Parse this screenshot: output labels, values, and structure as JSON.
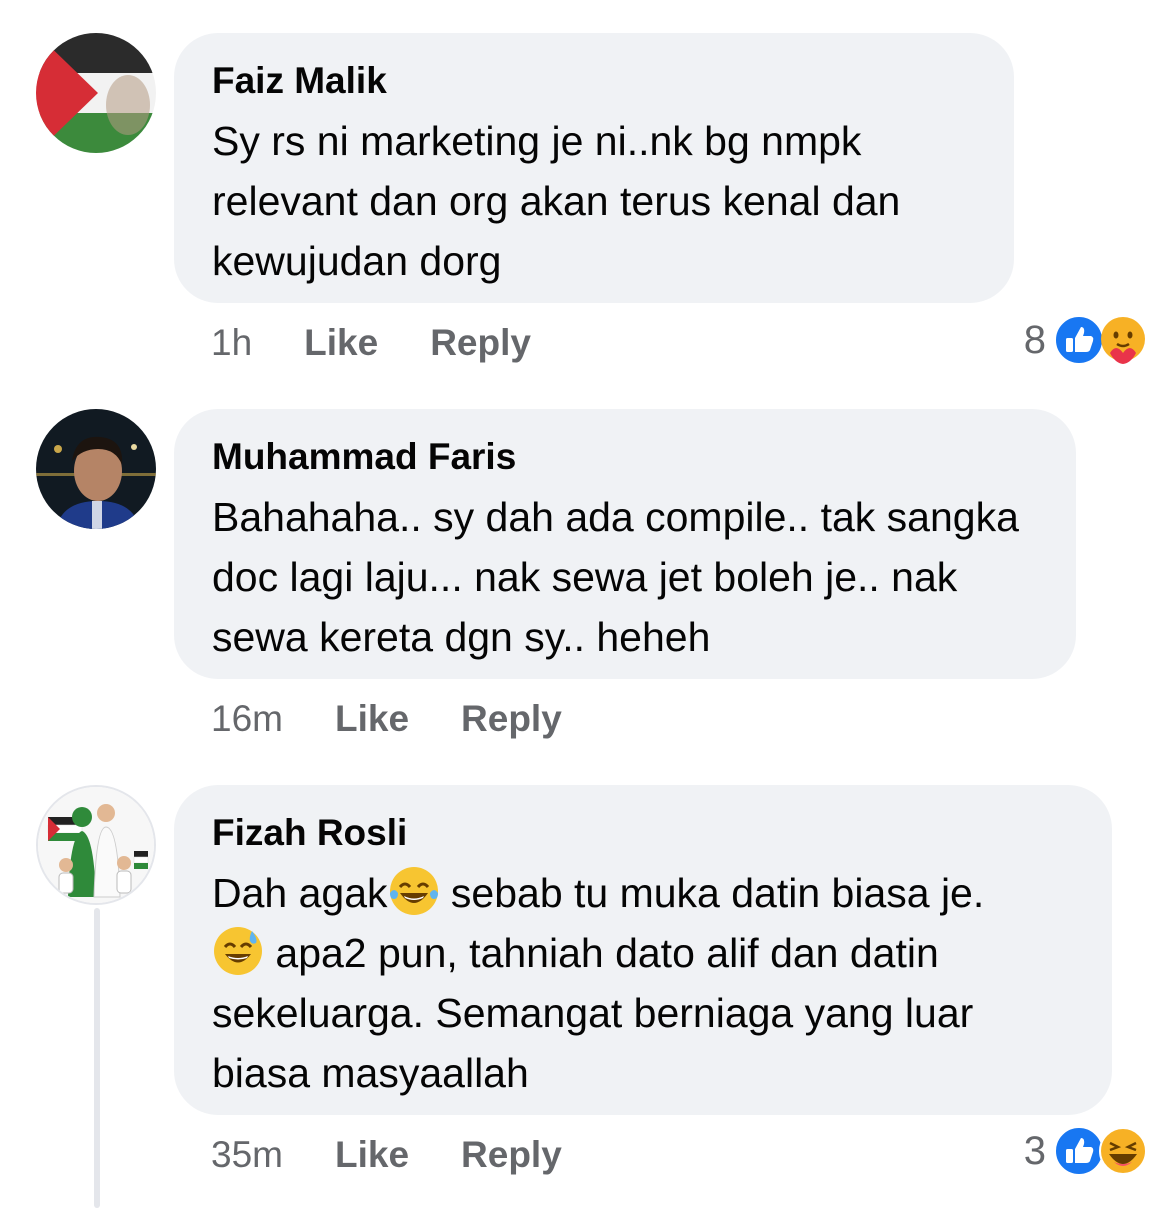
{
  "comments": [
    {
      "author": "Faiz Malik",
      "text": "Sy rs ni marketing je ni..nk bg nmpk relevant dan org akan terus kenal dan kewujudan dorg",
      "time": "1h",
      "like_label": "Like",
      "reply_label": "Reply",
      "reaction_count": "8",
      "reactions": [
        "like-icon",
        "care-icon"
      ]
    },
    {
      "author": "Muhammad Faris",
      "text": "Bahahaha.. sy dah ada compile.. tak sangka doc lagi laju... nak sewa jet boleh je.. nak sewa kereta dgn sy.. heheh",
      "time": "16m",
      "like_label": "Like",
      "reply_label": "Reply"
    },
    {
      "author": "Fizah Rosli",
      "text_part1": "Dah agak",
      "text_part2": " sebab tu muka datin biasa je.",
      "text_part3": " apa2 pun, tahniah dato alif dan datin",
      "text_part4": "sekeluarga. Semangat berniaga yang luar",
      "text_part5": "biasa masyaallah",
      "inline_emojis": [
        "laughing-tears-emoji",
        "sweat-smile-emoji"
      ],
      "time": "35m",
      "like_label": "Like",
      "reply_label": "Reply",
      "reaction_count": "3",
      "reactions": [
        "like-icon",
        "haha-icon"
      ]
    }
  ],
  "colors": {
    "bubble": "#f0f2f5",
    "meta_text": "#65676b",
    "like_blue": "#1877f2",
    "thread_line": "#e4e6eb"
  }
}
